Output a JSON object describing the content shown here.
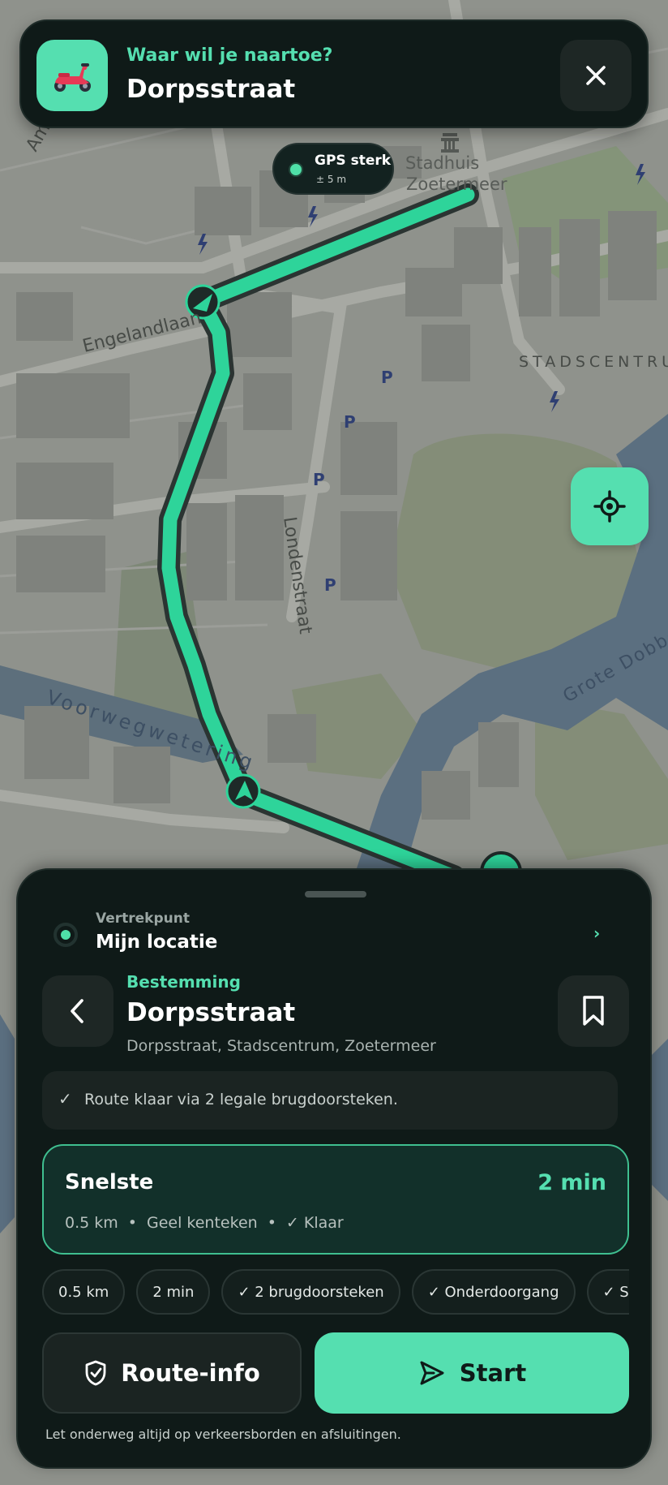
{
  "header": {
    "prompt": "Waar wil je naartoe?",
    "destination": "Dorpsstraat"
  },
  "gps": {
    "status": "GPS sterk",
    "accuracy": "± 5 m"
  },
  "map": {
    "labels": {
      "street_engelandlaan": "Engelandlaan",
      "street_londenstraat": "Londenstraat",
      "water_voorwegwetering": "Voorwegwetering",
      "water_grote_dobbe": "Grote Dobbe",
      "district_stadscentrum": "STADSCENTRU",
      "poi_stadhuis_1": "Stadhuis",
      "poi_stadhuis_2": "Zoetermeer",
      "street_top_left": "Am"
    },
    "parking_label": "P"
  },
  "sheet": {
    "origin_label": "Vertrekpunt",
    "origin_value": "Mijn locatie",
    "origin_chevron": "›",
    "destination_label": "Bestemming",
    "destination_name": "Dorpsstraat",
    "destination_address": "Dorpsstraat, Stadscentrum, Zoetermeer",
    "notice_check": "✓",
    "notice_text": "Route klaar via 2 legale brugdoorsteken.",
    "route": {
      "name": "Snelste",
      "time": "2 min",
      "distance": "0.5 km",
      "plate": "Geel kenteken",
      "status": "✓ Klaar",
      "separator": "•"
    },
    "chips": [
      "0.5 km",
      "2 min",
      "✓ 2 brugdoorsteken",
      "✓ Onderdoorgang",
      "✓ Scooterroute"
    ],
    "route_info_label": "Route-info",
    "start_label": "Start",
    "footer_note": "Let onderweg altijd op verkeersborden en afsluitingen."
  },
  "colors": {
    "accent": "#55dfb0",
    "panel": "#0f1a18",
    "route_line": "#2ed49a"
  },
  "icons": {
    "app": "scooter-icon",
    "close": "close-icon",
    "locate": "crosshair-icon",
    "back": "chevron-left-icon",
    "save": "bookmark-icon",
    "route_info": "shield-check-icon",
    "start": "navigation-arrow-icon"
  }
}
